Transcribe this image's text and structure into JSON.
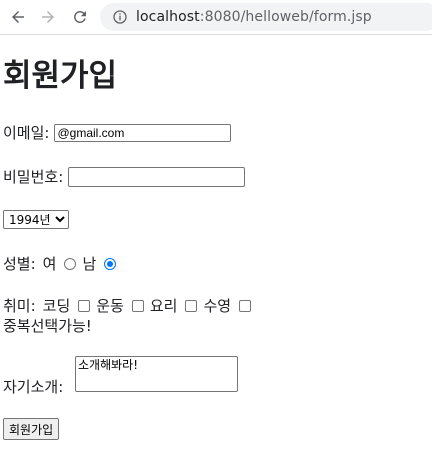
{
  "browser": {
    "url_host": "localhost",
    "url_rest": ":8080/helloweb/form.jsp"
  },
  "page": {
    "title": "회원가입",
    "email_label": "이메일:",
    "email_value": "@gmail.com",
    "password_label": "비밀번호:",
    "password_value": "",
    "year_selected": "1994년",
    "gender_label": "성별:",
    "gender_female": "여",
    "gender_male": "남",
    "hobby_label": "취미:",
    "hobbies": [
      "코딩",
      "운동",
      "요리",
      "수영"
    ],
    "hobby_note": "중복선택가능!",
    "intro_label": "자기소개:",
    "intro_value": "소개해봐라!",
    "submit_label": "회원가입"
  },
  "colors": {
    "radio_selected": "#0075ff"
  }
}
